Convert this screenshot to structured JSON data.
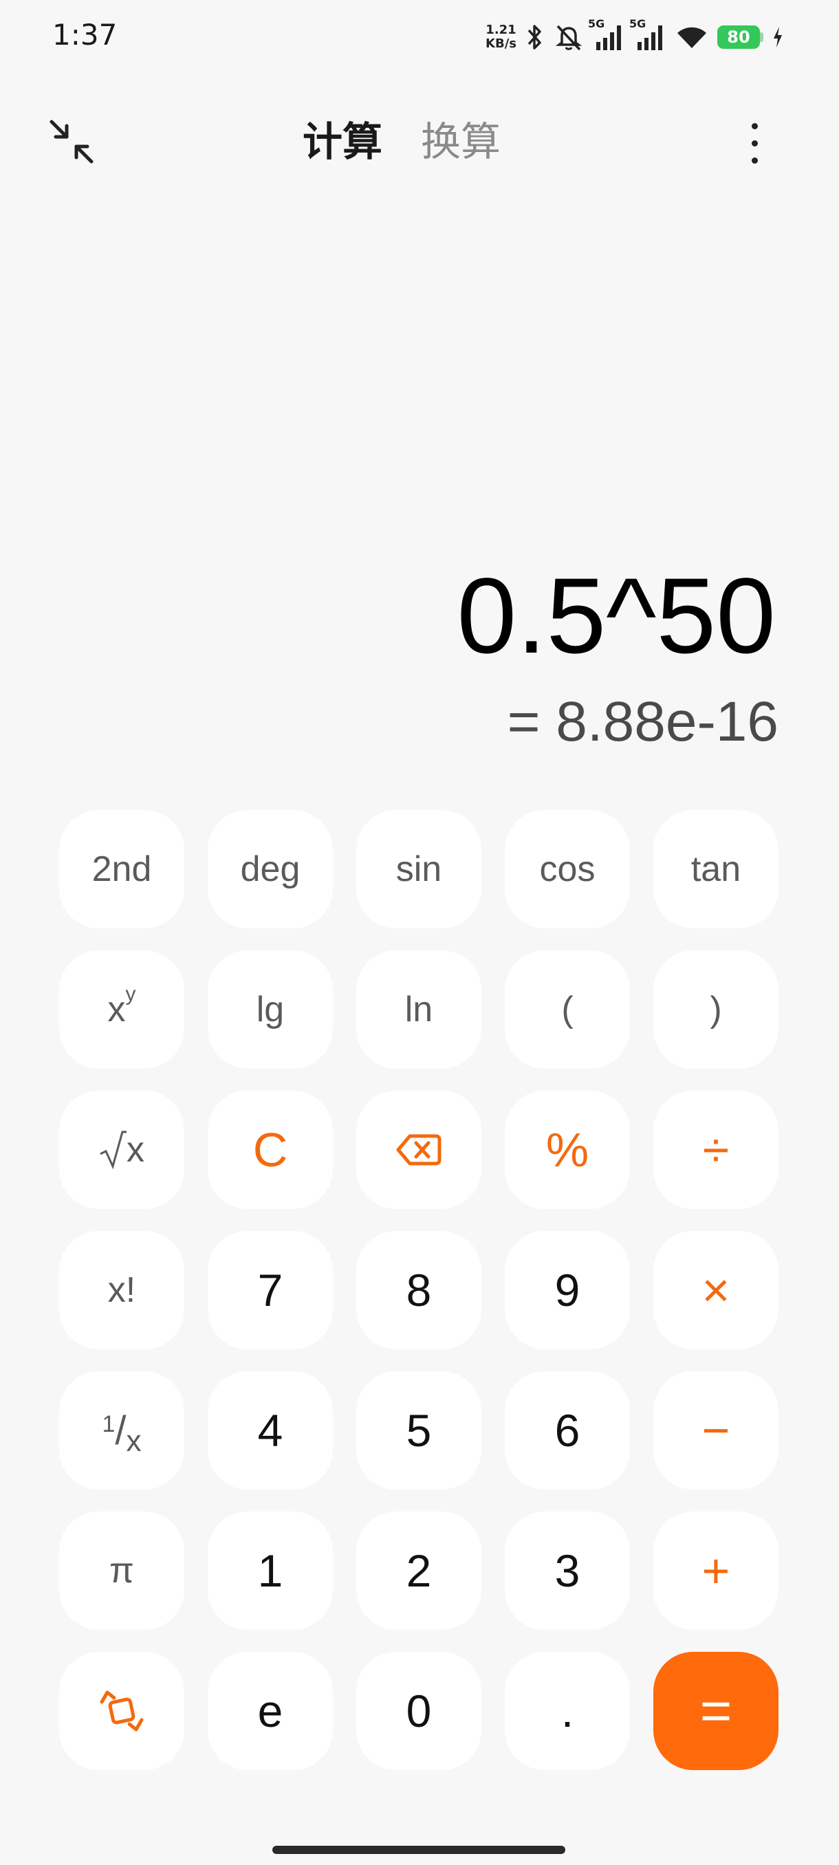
{
  "status_bar": {
    "time": "1:37",
    "net_speed_value": "1.21",
    "net_speed_unit": "KB/s",
    "signal1_label": "5G",
    "signal2_label": "5G",
    "battery_level": "80",
    "icons": [
      "bluetooth-icon",
      "bell-off-icon",
      "signal-icon",
      "signal-icon",
      "wifi-icon",
      "battery-icon",
      "charging-icon"
    ]
  },
  "header": {
    "tabs": [
      {
        "label": "计算",
        "active": true
      },
      {
        "label": "换算",
        "active": false
      }
    ],
    "icons": [
      "collapse-icon",
      "more-icon"
    ]
  },
  "display": {
    "expression": "0.5^50",
    "result": "= 8.88e-16"
  },
  "keypad": {
    "row1": [
      "2nd",
      "deg",
      "sin",
      "cos",
      "tan"
    ],
    "row2": {
      "xy_base": "x",
      "xy_exp": "y",
      "lg": "lg",
      "ln": "ln",
      "lparen": "(",
      "rparen": ")"
    },
    "row3": {
      "sqrt_x": "x",
      "clear": "C",
      "percent": "%",
      "divide": "÷"
    },
    "row4": {
      "fact": "x!",
      "k7": "7",
      "k8": "8",
      "k9": "9",
      "multiply": "×"
    },
    "row5": {
      "recip_num": "1",
      "recip_den": "x",
      "k4": "4",
      "k5": "5",
      "k6": "6",
      "minus": "−"
    },
    "row6": {
      "pi": "π",
      "k1": "1",
      "k2": "2",
      "k3": "3",
      "plus": "+"
    },
    "row7": {
      "e": "e",
      "k0": "0",
      "dot": ".",
      "equals": "="
    }
  },
  "colors": {
    "accent": "#ff6a0d",
    "background": "#f7f7f7",
    "key": "#ffffff"
  }
}
